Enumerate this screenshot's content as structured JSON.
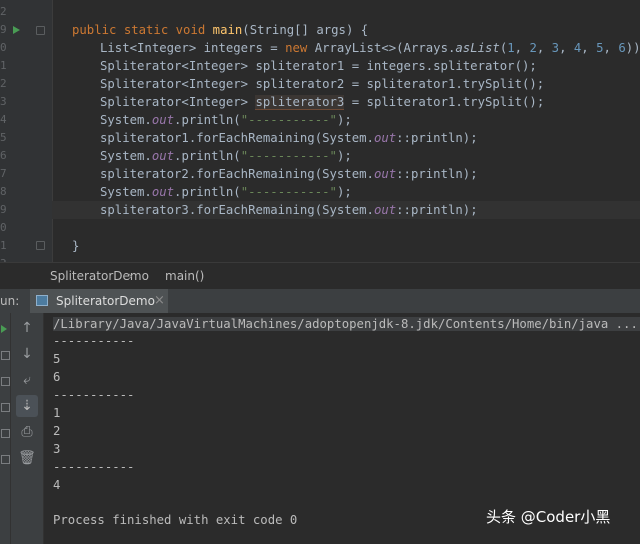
{
  "editor": {
    "line_numbers": [
      "9",
      "0",
      "1",
      "2",
      "3",
      "4",
      "5",
      "6",
      "7",
      "8",
      "9",
      "0",
      "1",
      "2",
      "3"
    ],
    "run_gutter_icon": "run-arrow-icon",
    "code": {
      "l1_kw": "public static void ",
      "l1_fn": "main",
      "l1_rest": "(String[] args) {",
      "l2_a": "List<Integer> integers = ",
      "l2_new": "new ",
      "l2_b": "ArrayList<>(Arrays.",
      "l2_aslist": "asList",
      "l2_open": "(",
      "l2_nums": [
        "1",
        "2",
        "3",
        "4",
        "5",
        "6"
      ],
      "l2_sep": ", ",
      "l2_close": "));",
      "l3": "Spliterator<Integer> spliterator1 = integers.spliterator();",
      "l4": "Spliterator<Integer> spliterator2 = spliterator1.trySplit();",
      "l5_a": "Spliterator<Integer> ",
      "l5_var": "spliterator3",
      "l5_b": " = spliterator1.trySplit();",
      "sys": "System.",
      "out": "out",
      "println_open": ".println(",
      "dashes_str": "\"-----------\"",
      "close_paren": ");",
      "fe1_a": "spliterator1.forEachRemaining(System.",
      "fe2_a": "spliterator2.forEachRemaining(System.",
      "fe3_a": "spliterator3.forEachRemaining(System.",
      "fe_b": "::println);",
      "brace": "}"
    }
  },
  "breadcrumb": {
    "class_name": "SpliteratorDemo",
    "separator": "›",
    "method_name": "main()"
  },
  "run_panel": {
    "label": "un:",
    "tab_title": "SpliteratorDemo",
    "tab_close": "×",
    "tools": [
      "arrow-up-icon",
      "arrow-down-icon",
      "soft-wrap-icon",
      "scroll-to-end-icon",
      "print-icon",
      "trash-icon"
    ]
  },
  "console": {
    "command": "/Library/Java/JavaVirtualMachines/adoptopenjdk-8.jdk/Contents/Home/bin/java ...",
    "lines": [
      "-----------",
      "5",
      "6",
      "-----------",
      "1",
      "2",
      "3",
      "-----------",
      "4",
      "",
      "Process finished with exit code 0"
    ]
  },
  "watermark": "头条 @Coder小黑"
}
